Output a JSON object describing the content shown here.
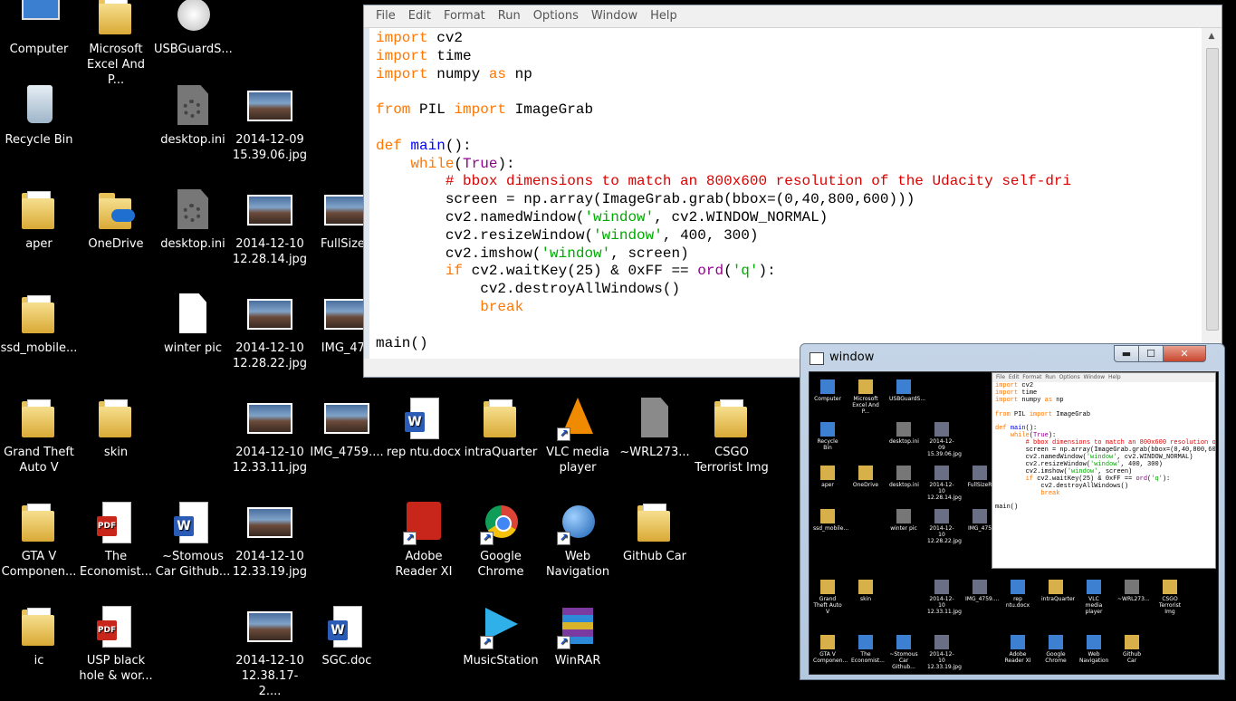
{
  "desktop": {
    "icons": [
      {
        "label": "Computer",
        "icon": "computer-icon"
      },
      {
        "label": "Microsoft\nExcel And P...",
        "icon": "folder-icon"
      },
      {
        "label": "USBGuardS...",
        "icon": "usb-guard-icon"
      },
      {
        "label": "Recycle Bin",
        "icon": "recycle-bin-icon"
      },
      {
        "label": "desktop.ini",
        "icon": "settings-file-icon"
      },
      {
        "label": "2014-12-09\n15.39.06.jpg",
        "icon": "photo-icon"
      },
      {
        "label": "aper",
        "icon": "folder-icon"
      },
      {
        "label": "OneDrive",
        "icon": "onedrive-folder-icon"
      },
      {
        "label": "desktop.ini",
        "icon": "settings-file-icon"
      },
      {
        "label": "2014-12-10\n12.28.14.jpg",
        "icon": "photo-icon"
      },
      {
        "label": "FullSizeR",
        "icon": "photo-icon"
      },
      {
        "label": "ssd_mobile...",
        "icon": "folder-icon"
      },
      {
        "label": "winter pic",
        "icon": "blank-file-icon"
      },
      {
        "label": "2014-12-10\n12.28.22.jpg",
        "icon": "photo-icon"
      },
      {
        "label": "IMG_475",
        "icon": "photo-icon"
      },
      {
        "label": "Grand Theft\nAuto V",
        "icon": "folder-icon"
      },
      {
        "label": "skin",
        "icon": "folder-icon"
      },
      {
        "label": "2014-12-10\n12.33.11.jpg",
        "icon": "photo-icon"
      },
      {
        "label": "IMG_4759....",
        "icon": "photo-icon"
      },
      {
        "label": "rep ntu.docx",
        "icon": "word-doc-icon"
      },
      {
        "label": "intraQuarter",
        "icon": "folder-icon"
      },
      {
        "label": "VLC media\nplayer",
        "icon": "vlc-icon"
      },
      {
        "label": "~WRL273...",
        "icon": "grey-file-icon"
      },
      {
        "label": "CSGO\nTerrorist Img",
        "icon": "folder-icon"
      },
      {
        "label": "GTA V\nComponen...",
        "icon": "folder-icon"
      },
      {
        "label": "The\nEconomist...",
        "icon": "pdf-icon"
      },
      {
        "label": "~Stomous\nCar Github...",
        "icon": "word-doc-icon"
      },
      {
        "label": "2014-12-10\n12.33.19.jpg",
        "icon": "photo-icon"
      },
      {
        "label": "Adobe\nReader XI",
        "icon": "adobe-reader-icon"
      },
      {
        "label": "Google\nChrome",
        "icon": "chrome-icon"
      },
      {
        "label": "Web\nNavigation",
        "icon": "globe-icon"
      },
      {
        "label": "Github Car",
        "icon": "folder-icon"
      },
      {
        "label": "ic",
        "icon": "folder-icon"
      },
      {
        "label": "USP black\nhole & wor...",
        "icon": "pdf-icon"
      },
      {
        "label": "2014-12-10\n12.38.17-2....",
        "icon": "photo-icon"
      },
      {
        "label": "SGC.doc",
        "icon": "word-doc-icon"
      },
      {
        "label": "MusicStation",
        "icon": "music-station-icon"
      },
      {
        "label": "WinRAR",
        "icon": "winrar-icon"
      }
    ]
  },
  "editor": {
    "menu": [
      "File",
      "Edit",
      "Format",
      "Run",
      "Options",
      "Window",
      "Help"
    ],
    "lines": [
      [
        {
          "t": "import",
          "c": "kw"
        },
        {
          "t": " cv2",
          "c": ""
        }
      ],
      [
        {
          "t": "import",
          "c": "kw"
        },
        {
          "t": " time",
          "c": ""
        }
      ],
      [
        {
          "t": "import",
          "c": "kw"
        },
        {
          "t": " numpy ",
          "c": ""
        },
        {
          "t": "as",
          "c": "kw"
        },
        {
          "t": " np",
          "c": ""
        }
      ],
      [],
      [
        {
          "t": "from",
          "c": "kw"
        },
        {
          "t": " PIL ",
          "c": ""
        },
        {
          "t": "import",
          "c": "kw"
        },
        {
          "t": " ImageGrab",
          "c": ""
        }
      ],
      [],
      [
        {
          "t": "def",
          "c": "kw"
        },
        {
          "t": " ",
          "c": ""
        },
        {
          "t": "main",
          "c": "df"
        },
        {
          "t": "():",
          "c": ""
        }
      ],
      [
        {
          "t": "    ",
          "c": ""
        },
        {
          "t": "while",
          "c": "kw"
        },
        {
          "t": "(",
          "c": ""
        },
        {
          "t": "True",
          "c": "bi"
        },
        {
          "t": "):",
          "c": ""
        }
      ],
      [
        {
          "t": "        ",
          "c": ""
        },
        {
          "t": "# bbox dimensions to match an 800x600 resolution of the Udacity self-dri",
          "c": "cm"
        }
      ],
      [
        {
          "t": "        screen = np.array(ImageGrab.grab(bbox=(0,40,800,600)))",
          "c": ""
        }
      ],
      [
        {
          "t": "        cv2.namedWindow(",
          "c": ""
        },
        {
          "t": "'window'",
          "c": "st"
        },
        {
          "t": ", cv2.WINDOW_NORMAL)",
          "c": ""
        }
      ],
      [
        {
          "t": "        cv2.resizeWindow(",
          "c": ""
        },
        {
          "t": "'window'",
          "c": "st"
        },
        {
          "t": ", 400, 300)",
          "c": ""
        }
      ],
      [
        {
          "t": "        cv2.imshow(",
          "c": ""
        },
        {
          "t": "'window'",
          "c": "st"
        },
        {
          "t": ", screen)",
          "c": ""
        }
      ],
      [
        {
          "t": "        ",
          "c": ""
        },
        {
          "t": "if",
          "c": "kw"
        },
        {
          "t": " cv2.waitKey(25) & 0xFF == ",
          "c": ""
        },
        {
          "t": "ord",
          "c": "bi"
        },
        {
          "t": "(",
          "c": ""
        },
        {
          "t": "'q'",
          "c": "st"
        },
        {
          "t": "):",
          "c": ""
        }
      ],
      [
        {
          "t": "            cv2.destroyAllWindows()",
          "c": ""
        }
      ],
      [
        {
          "t": "            ",
          "c": ""
        },
        {
          "t": "break",
          "c": "kw"
        }
      ],
      [],
      [
        {
          "t": "main()",
          "c": ""
        }
      ]
    ]
  },
  "cv_window": {
    "title": "window",
    "controls": {
      "minimize": "▬",
      "maximize": "☐",
      "close": "✕"
    },
    "mini_menu": "File  Edit  Format  Run  Options  Window  Help",
    "mini_icons": [
      "Computer",
      "Microsoft Excel And P...",
      "USBGuardS...",
      "Recycle Bin",
      "desktop.ini",
      "2014-12-09 15.39.06.jpg",
      "aper",
      "OneDrive",
      "desktop.ini",
      "2014-12-10 12.28.14.jpg",
      "FullSizeR",
      "ssd_mobile...",
      "winter pic",
      "2014-12-10 12.28.22.jpg",
      "IMG_475",
      "Grand Theft Auto V",
      "skin",
      "2014-12-10 12.33.11.jpg",
      "IMG_4759....",
      "rep ntu.docx",
      "intraQuarter",
      "VLC media player",
      "~WRL273...",
      "CSGO Terrorist Img",
      "GTA V Componen...",
      "The Economist...",
      "~Stomous Car Github...",
      "2014-12-10 12.33.19.jpg",
      "Adobe Reader XI",
      "Google Chrome",
      "Web Navigation",
      "Github Car"
    ]
  },
  "colors": {
    "keyword": "#ff7700",
    "builtin": "#900090",
    "string": "#00aa00",
    "comment": "#dd0000",
    "definition": "#0000ff"
  }
}
